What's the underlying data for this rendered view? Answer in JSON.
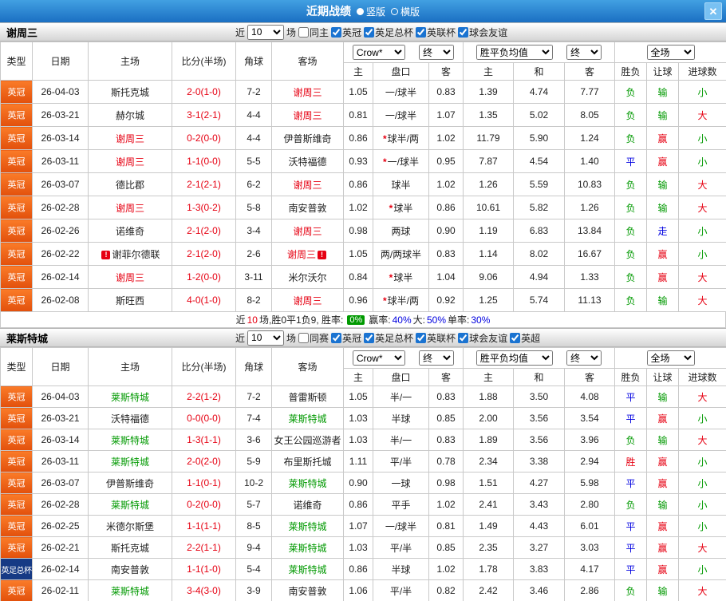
{
  "titlebar": {
    "title": "近期战绩",
    "vertical": "竖版",
    "horizontal": "横版",
    "close_glyph": "✕"
  },
  "controls": {
    "near": "近",
    "games": "10",
    "games_suffix": "场",
    "company": "Crow*",
    "final": "终",
    "avg": "胜平负均值",
    "scope": "全场"
  },
  "columns": {
    "type": "类型",
    "date": "日期",
    "home": "主场",
    "score": "比分(半场)",
    "corner": "角球",
    "away": "客场",
    "odds_home": "主",
    "handicap": "盘口",
    "odds_away": "客",
    "avg_home": "主",
    "avg_draw": "和",
    "avg_away": "客",
    "result": "胜负",
    "let": "让球",
    "goals": "进球数"
  },
  "colors": {
    "accent_blue": "#1a6fc2",
    "league_orange": "#e2500c",
    "cup_navy": "#163a85",
    "win_red": "#e60012",
    "lose_green": "#009900",
    "draw_blue": "#0000e0"
  },
  "section1": {
    "team": "谢周三",
    "same_label": "同主",
    "leagues": [
      "英冠",
      "英足总杯",
      "英联杯",
      "球会友谊"
    ],
    "rows": [
      {
        "type": "英冠",
        "type_style": "orange",
        "date": "26-04-03",
        "home": "斯托克城",
        "home_style": "",
        "home_warn": "",
        "score": "2-0(1-0)",
        "corner": "7-2",
        "away": "谢周三",
        "away_style": "red",
        "away_warn": "",
        "odds_home": "1.05",
        "star": "",
        "handicap": "一/球半",
        "odds_away": "0.83",
        "avg_home": "1.39",
        "avg_draw": "4.74",
        "avg_away": "7.77",
        "result": "负",
        "result_style": "green",
        "let": "输",
        "let_style": "green",
        "goal": "小",
        "goal_style": "green"
      },
      {
        "type": "英冠",
        "type_style": "orange",
        "date": "26-03-21",
        "home": "赫尔城",
        "home_style": "",
        "home_warn": "",
        "score": "3-1(2-1)",
        "corner": "4-4",
        "away": "谢周三",
        "away_style": "red",
        "away_warn": "",
        "odds_home": "0.81",
        "star": "",
        "handicap": "一/球半",
        "odds_away": "1.07",
        "avg_home": "1.35",
        "avg_draw": "5.02",
        "avg_away": "8.05",
        "result": "负",
        "result_style": "green",
        "let": "输",
        "let_style": "green",
        "goal": "大",
        "goal_style": "red"
      },
      {
        "type": "英冠",
        "type_style": "orange",
        "date": "26-03-14",
        "home": "谢周三",
        "home_style": "red",
        "home_warn": "",
        "score": "0-2(0-0)",
        "corner": "4-4",
        "away": "伊普斯维奇",
        "away_style": "",
        "away_warn": "",
        "odds_home": "0.86",
        "star": "*",
        "handicap": "球半/两",
        "odds_away": "1.02",
        "avg_home": "11.79",
        "avg_draw": "5.90",
        "avg_away": "1.24",
        "result": "负",
        "result_style": "green",
        "let": "赢",
        "let_style": "red",
        "goal": "小",
        "goal_style": "green"
      },
      {
        "type": "英冠",
        "type_style": "orange",
        "date": "26-03-11",
        "home": "谢周三",
        "home_style": "red",
        "home_warn": "",
        "score": "1-1(0-0)",
        "corner": "5-5",
        "away": "沃特福德",
        "away_style": "",
        "away_warn": "",
        "odds_home": "0.93",
        "star": "*",
        "handicap": "一/球半",
        "odds_away": "0.95",
        "avg_home": "7.87",
        "avg_draw": "4.54",
        "avg_away": "1.40",
        "result": "平",
        "result_style": "blue",
        "let": "赢",
        "let_style": "red",
        "goal": "小",
        "goal_style": "green"
      },
      {
        "type": "英冠",
        "type_style": "orange",
        "date": "26-03-07",
        "home": "德比郡",
        "home_style": "",
        "home_warn": "",
        "score": "2-1(2-1)",
        "corner": "6-2",
        "away": "谢周三",
        "away_style": "red",
        "away_warn": "",
        "odds_home": "0.86",
        "star": "",
        "handicap": "球半",
        "odds_away": "1.02",
        "avg_home": "1.26",
        "avg_draw": "5.59",
        "avg_away": "10.83",
        "result": "负",
        "result_style": "green",
        "let": "输",
        "let_style": "green",
        "goal": "大",
        "goal_style": "red"
      },
      {
        "type": "英冠",
        "type_style": "orange",
        "date": "26-02-28",
        "home": "谢周三",
        "home_style": "red",
        "home_warn": "",
        "score": "1-3(0-2)",
        "corner": "5-8",
        "away": "南安普敦",
        "away_style": "",
        "away_warn": "",
        "odds_home": "1.02",
        "star": "*",
        "handicap": "球半",
        "odds_away": "0.86",
        "avg_home": "10.61",
        "avg_draw": "5.82",
        "avg_away": "1.26",
        "result": "负",
        "result_style": "green",
        "let": "输",
        "let_style": "green",
        "goal": "大",
        "goal_style": "red"
      },
      {
        "type": "英冠",
        "type_style": "orange",
        "date": "26-02-26",
        "home": "诺维奇",
        "home_style": "",
        "home_warn": "",
        "score": "2-1(2-0)",
        "corner": "3-4",
        "away": "谢周三",
        "away_style": "red",
        "away_warn": "",
        "odds_home": "0.98",
        "star": "",
        "handicap": "两球",
        "odds_away": "0.90",
        "avg_home": "1.19",
        "avg_draw": "6.83",
        "avg_away": "13.84",
        "result": "负",
        "result_style": "green",
        "let": "走",
        "let_style": "blue",
        "goal": "小",
        "goal_style": "green"
      },
      {
        "type": "英冠",
        "type_style": "orange",
        "date": "26-02-22",
        "home": "谢菲尔德联",
        "home_style": "",
        "home_warn": "!",
        "score": "2-1(2-0)",
        "corner": "2-6",
        "away": "谢周三",
        "away_style": "red",
        "away_warn": "!",
        "odds_home": "1.05",
        "star": "",
        "handicap": "两/两球半",
        "odds_away": "0.83",
        "avg_home": "1.14",
        "avg_draw": "8.02",
        "avg_away": "16.67",
        "result": "负",
        "result_style": "green",
        "let": "赢",
        "let_style": "red",
        "goal": "小",
        "goal_style": "green"
      },
      {
        "type": "英冠",
        "type_style": "orange",
        "date": "26-02-14",
        "home": "谢周三",
        "home_style": "red",
        "home_warn": "",
        "score": "1-2(0-0)",
        "corner": "3-11",
        "away": "米尔沃尔",
        "away_style": "",
        "away_warn": "",
        "odds_home": "0.84",
        "star": "*",
        "handicap": "球半",
        "odds_away": "1.04",
        "avg_home": "9.06",
        "avg_draw": "4.94",
        "avg_away": "1.33",
        "result": "负",
        "result_style": "green",
        "let": "赢",
        "let_style": "red",
        "goal": "大",
        "goal_style": "red"
      },
      {
        "type": "英冠",
        "type_style": "orange",
        "date": "26-02-08",
        "home": "斯旺西",
        "home_style": "",
        "home_warn": "",
        "score": "4-0(1-0)",
        "corner": "8-2",
        "away": "谢周三",
        "away_style": "red",
        "away_warn": "",
        "odds_home": "0.96",
        "star": "*",
        "handicap": "球半/两",
        "odds_away": "0.92",
        "avg_home": "1.25",
        "avg_draw": "5.74",
        "avg_away": "11.13",
        "result": "负",
        "result_style": "green",
        "let": "输",
        "let_style": "green",
        "goal": "大",
        "goal_style": "red"
      }
    ],
    "summary": {
      "prefix": "近",
      "count": "10",
      "record": "场,胜0平1负9, 胜率:",
      "win_rate": "0%",
      "asian_label": "赢率:",
      "asian_rate": "40%",
      "big_label": "大:",
      "big_rate": "50%",
      "single_label": "单率:",
      "single_rate": "30%"
    }
  },
  "section2": {
    "team": "莱斯特城",
    "same_label": "同赛",
    "leagues": [
      "英冠",
      "英足总杯",
      "英联杯",
      "球会友谊",
      "英超"
    ],
    "rows": [
      {
        "type": "英冠",
        "type_style": "orange",
        "date": "26-04-03",
        "home": "莱斯特城",
        "home_style": "green",
        "home_warn": "",
        "score": "2-2(1-2)",
        "corner": "7-2",
        "away": "普雷斯顿",
        "away_style": "",
        "away_warn": "",
        "odds_home": "1.05",
        "star": "",
        "handicap": "半/一",
        "odds_away": "0.83",
        "avg_home": "1.88",
        "avg_draw": "3.50",
        "avg_away": "4.08",
        "result": "平",
        "result_style": "blue",
        "let": "输",
        "let_style": "green",
        "goal": "大",
        "goal_style": "red"
      },
      {
        "type": "英冠",
        "type_style": "orange",
        "date": "26-03-21",
        "home": "沃特福德",
        "home_style": "",
        "home_warn": "",
        "score": "0-0(0-0)",
        "corner": "7-4",
        "away": "莱斯特城",
        "away_style": "green",
        "away_warn": "",
        "odds_home": "1.03",
        "star": "",
        "handicap": "半球",
        "odds_away": "0.85",
        "avg_home": "2.00",
        "avg_draw": "3.56",
        "avg_away": "3.54",
        "result": "平",
        "result_style": "blue",
        "let": "赢",
        "let_style": "red",
        "goal": "小",
        "goal_style": "green"
      },
      {
        "type": "英冠",
        "type_style": "orange",
        "date": "26-03-14",
        "home": "莱斯特城",
        "home_style": "green",
        "home_warn": "",
        "score": "1-3(1-1)",
        "corner": "3-6",
        "away": "女王公园巡游者",
        "away_style": "",
        "away_warn": "",
        "odds_home": "1.03",
        "star": "",
        "handicap": "半/一",
        "odds_away": "0.83",
        "avg_home": "1.89",
        "avg_draw": "3.56",
        "avg_away": "3.96",
        "result": "负",
        "result_style": "green",
        "let": "输",
        "let_style": "green",
        "goal": "大",
        "goal_style": "red"
      },
      {
        "type": "英冠",
        "type_style": "orange",
        "date": "26-03-11",
        "home": "莱斯特城",
        "home_style": "green",
        "home_warn": "",
        "score": "2-0(2-0)",
        "corner": "5-9",
        "away": "布里斯托城",
        "away_style": "",
        "away_warn": "",
        "odds_home": "1.11",
        "star": "",
        "handicap": "平/半",
        "odds_away": "0.78",
        "avg_home": "2.34",
        "avg_draw": "3.38",
        "avg_away": "2.94",
        "result": "胜",
        "result_style": "red",
        "let": "赢",
        "let_style": "red",
        "goal": "小",
        "goal_style": "green"
      },
      {
        "type": "英冠",
        "type_style": "orange",
        "date": "26-03-07",
        "home": "伊普斯维奇",
        "home_style": "",
        "home_warn": "",
        "score": "1-1(0-1)",
        "corner": "10-2",
        "away": "莱斯特城",
        "away_style": "green",
        "away_warn": "",
        "odds_home": "0.90",
        "star": "",
        "handicap": "一球",
        "odds_away": "0.98",
        "avg_home": "1.51",
        "avg_draw": "4.27",
        "avg_away": "5.98",
        "result": "平",
        "result_style": "blue",
        "let": "赢",
        "let_style": "red",
        "goal": "小",
        "goal_style": "green"
      },
      {
        "type": "英冠",
        "type_style": "orange",
        "date": "26-02-28",
        "home": "莱斯特城",
        "home_style": "green",
        "home_warn": "",
        "score": "0-2(0-0)",
        "corner": "5-7",
        "away": "诺维奇",
        "away_style": "",
        "away_warn": "",
        "odds_home": "0.86",
        "star": "",
        "handicap": "平手",
        "odds_away": "1.02",
        "avg_home": "2.41",
        "avg_draw": "3.43",
        "avg_away": "2.80",
        "result": "负",
        "result_style": "green",
        "let": "输",
        "let_style": "green",
        "goal": "小",
        "goal_style": "green"
      },
      {
        "type": "英冠",
        "type_style": "orange",
        "date": "26-02-25",
        "home": "米德尔斯堡",
        "home_style": "",
        "home_warn": "",
        "score": "1-1(1-1)",
        "corner": "8-5",
        "away": "莱斯特城",
        "away_style": "green",
        "away_warn": "",
        "odds_home": "1.07",
        "star": "",
        "handicap": "一/球半",
        "odds_away": "0.81",
        "avg_home": "1.49",
        "avg_draw": "4.43",
        "avg_away": "6.01",
        "result": "平",
        "result_style": "blue",
        "let": "赢",
        "let_style": "red",
        "goal": "小",
        "goal_style": "green"
      },
      {
        "type": "英冠",
        "type_style": "orange",
        "date": "26-02-21",
        "home": "斯托克城",
        "home_style": "",
        "home_warn": "",
        "score": "2-2(1-1)",
        "corner": "9-4",
        "away": "莱斯特城",
        "away_style": "green",
        "away_warn": "",
        "odds_home": "1.03",
        "star": "",
        "handicap": "平/半",
        "odds_away": "0.85",
        "avg_home": "2.35",
        "avg_draw": "3.27",
        "avg_away": "3.03",
        "result": "平",
        "result_style": "blue",
        "let": "赢",
        "let_style": "red",
        "goal": "大",
        "goal_style": "red"
      },
      {
        "type": "英足总杯",
        "type_style": "navy",
        "date": "26-02-14",
        "home": "南安普敦",
        "home_style": "",
        "home_warn": "",
        "score": "1-1(1-0)",
        "corner": "5-4",
        "away": "莱斯特城",
        "away_style": "green",
        "away_warn": "",
        "odds_home": "0.86",
        "star": "",
        "handicap": "半球",
        "odds_away": "1.02",
        "avg_home": "1.78",
        "avg_draw": "3.83",
        "avg_away": "4.17",
        "result": "平",
        "result_style": "blue",
        "let": "赢",
        "let_style": "red",
        "goal": "小",
        "goal_style": "green"
      },
      {
        "type": "英冠",
        "type_style": "orange",
        "date": "26-02-11",
        "home": "莱斯特城",
        "home_style": "green",
        "home_warn": "",
        "score": "3-4(3-0)",
        "corner": "3-9",
        "away": "南安普敦",
        "away_style": "",
        "away_warn": "",
        "odds_home": "1.06",
        "star": "",
        "handicap": "平/半",
        "odds_away": "0.82",
        "avg_home": "2.42",
        "avg_draw": "3.46",
        "avg_away": "2.86",
        "result": "负",
        "result_style": "green",
        "let": "输",
        "let_style": "green",
        "goal": "大",
        "goal_style": "red"
      }
    ]
  }
}
